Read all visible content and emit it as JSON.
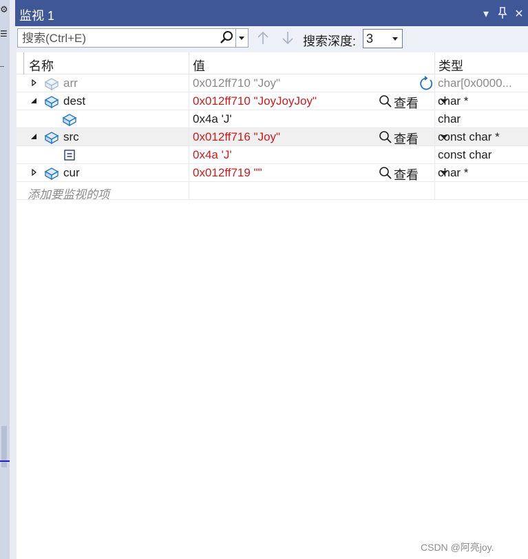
{
  "window": {
    "title": "监视 1",
    "buttons": {
      "dropdown": "▾",
      "pin": "📌",
      "close": "✕"
    }
  },
  "toolbar": {
    "search_placeholder": "搜索(Ctrl+E)",
    "depth_label": "搜索深度:",
    "depth_value": "3"
  },
  "columns": {
    "name": "名称",
    "value": "值",
    "type": "类型"
  },
  "rows": [
    {
      "name": "arr",
      "value": "0x012ff710 \"Joy\"",
      "type": "char[0x0000...",
      "expander": "collapsed",
      "icon": "variable-icon",
      "stale": true,
      "refresh": true
    },
    {
      "name": "dest",
      "value": "0x012ff710 \"JoyJoyJoy\"",
      "type": "char *",
      "expander": "expanded",
      "icon": "variable-icon",
      "changed": true,
      "view": "查看"
    },
    {
      "name": "",
      "value": "0x4a 'J'",
      "type": "char",
      "icon": "variable-icon",
      "child": true
    },
    {
      "name": "src",
      "value": "0x012ff716 \"Joy\"",
      "type": "const char *",
      "expander": "expanded",
      "icon": "variable-icon",
      "changed": true,
      "view": "查看",
      "selected": true
    },
    {
      "name": "",
      "value": "0x4a 'J'",
      "type": "const char",
      "icon": "field-icon",
      "child": true,
      "changed": true
    },
    {
      "name": "cur",
      "value": "0x012ff719 \"\"",
      "type": "char *",
      "expander": "collapsed",
      "icon": "variable-icon",
      "changed": true,
      "view": "查看"
    }
  ],
  "add_item_hint": "添加要监视的项",
  "watermark": "CSDN @阿亮joy.",
  "colors": {
    "title_bar": "#3f5797",
    "changed_value": "#d11a1a",
    "stale_text": "#8a8a8a",
    "icon_blue": "#1c74c8"
  }
}
